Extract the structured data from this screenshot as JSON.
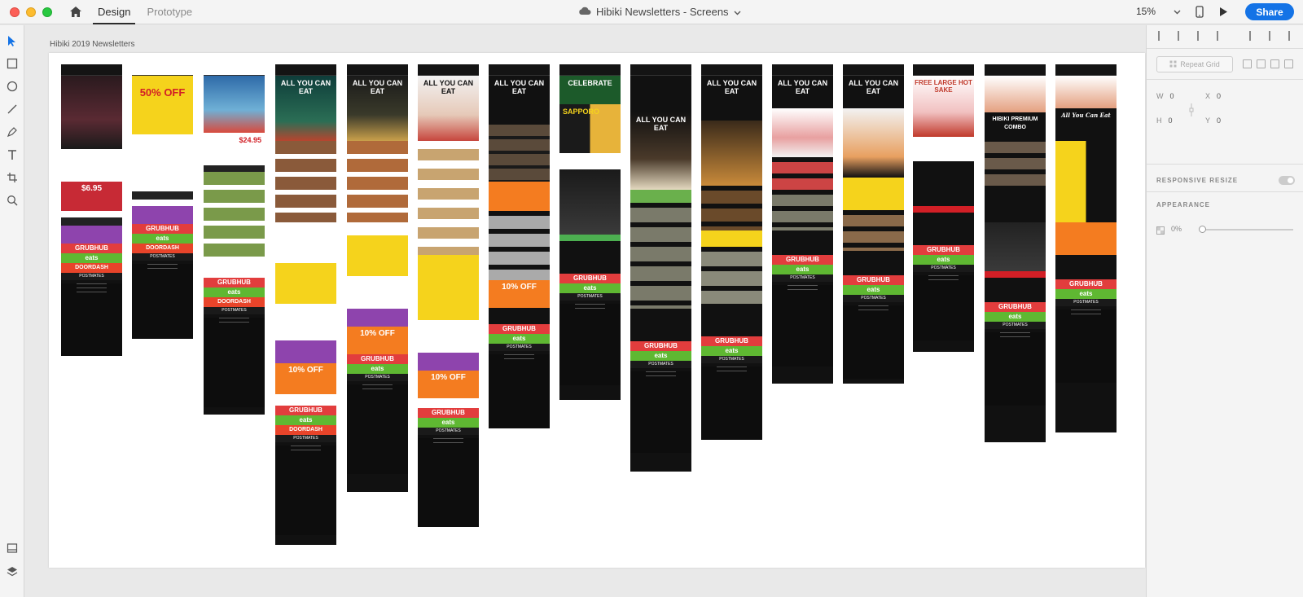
{
  "app": {
    "tabs": [
      {
        "label": "Design"
      },
      {
        "label": "Prototype"
      }
    ],
    "doc_title": "Hibiki Newsletters - Screens",
    "zoom": "15%",
    "share_label": "Share",
    "accent_color": "#1473e6"
  },
  "canvas": {
    "artboard_title": "Hibiki 2019 Newsletters"
  },
  "screens": {
    "s1": {
      "gh": "GRUBHUB",
      "ue": "eats",
      "dd": "DOORDASH",
      "pm": "POSTMATES",
      "price": "$6.95"
    },
    "s2": {
      "hero": "50% OFF",
      "gh": "GRUBHUB",
      "ue": "eats",
      "dd": "DOORDASH",
      "pm": "POSTMATES"
    },
    "s3": {
      "price": "$24.95",
      "gh": "GRUBHUB",
      "ue": "eats",
      "dd": "DOORDASH",
      "pm": "POSTMATES"
    },
    "s4": {
      "hero": "ALL YOU CAN EAT",
      "off": "10% OFF",
      "gh": "GRUBHUB",
      "ue": "eats",
      "dd": "DOORDASH",
      "pm": "POSTMATES"
    },
    "s5": {
      "hero": "ALL YOU CAN EAT",
      "off": "10% OFF",
      "gh": "GRUBHUB",
      "ue": "eats",
      "pm": "POSTMATES"
    },
    "s6": {
      "hero": "ALL YOU CAN EAT",
      "off": "10% OFF",
      "gh": "GRUBHUB",
      "ue": "eats",
      "pm": "POSTMATES"
    },
    "s7": {
      "hero": "ALL YOU CAN EAT",
      "off": "10% OFF",
      "gh": "GRUBHUB",
      "ue": "eats",
      "pm": "POSTMATES"
    },
    "s8": {
      "hero": "CELEBRATE",
      "brand": "SAPPORO",
      "gh": "GRUBHUB",
      "ue": "eats",
      "pm": "POSTMATES"
    },
    "s9": {
      "hero": "ALL YOU CAN EAT",
      "gh": "GRUBHUB",
      "ue": "eats",
      "pm": "POSTMATES"
    },
    "s10": {
      "hero": "ALL YOU CAN EAT",
      "gh": "GRUBHUB",
      "ue": "eats",
      "pm": "POSTMATES"
    },
    "s11": {
      "hero": "ALL YOU CAN EAT",
      "gh": "GRUBHUB",
      "ue": "eats",
      "pm": "POSTMATES"
    },
    "s12": {
      "hero": "ALL YOU CAN EAT",
      "gh": "GRUBHUB",
      "ue": "eats",
      "pm": "POSTMATES"
    },
    "s13": {
      "hero": "FREE LARGE HOT SAKE",
      "gh": "GRUBHUB",
      "ue": "eats",
      "pm": "POSTMATES"
    },
    "s14": {
      "hero": "HIBIKI PREMIUM COMBO",
      "gh": "GRUBHUB",
      "ue": "eats",
      "pm": "POSTMATES"
    },
    "s15": {
      "hero": "All You Can Eat",
      "gh": "GRUBHUB",
      "ue": "eats",
      "pm": "POSTMATES"
    }
  },
  "panel": {
    "repeat_grid": "Repeat Grid",
    "w_label": "W",
    "w_value": "0",
    "h_label": "H",
    "h_value": "0",
    "x_label": "X",
    "x_value": "0",
    "y_label": "Y",
    "y_value": "0",
    "responsive_resize": "RESPONSIVE RESIZE",
    "appearance": "APPEARANCE",
    "opacity": "0%"
  }
}
